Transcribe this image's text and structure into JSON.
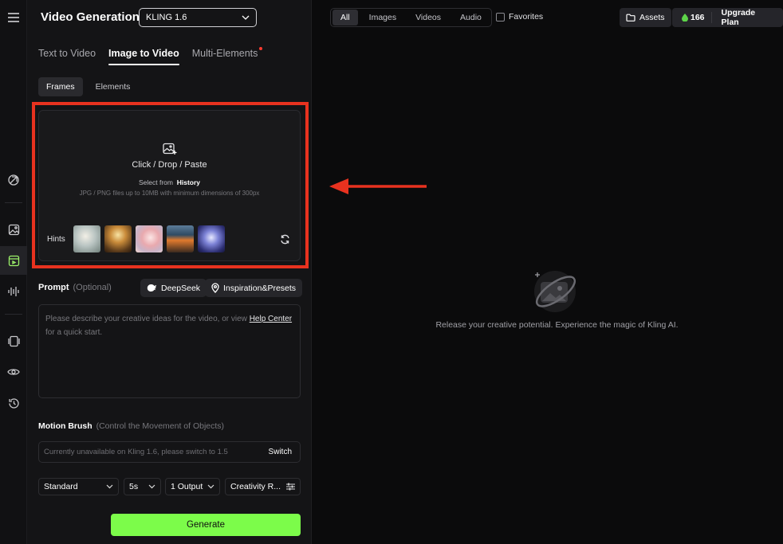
{
  "app": {
    "title": "Video Generation",
    "model": "KLING 1.6"
  },
  "tabs": [
    {
      "label": "Text to Video",
      "active": false
    },
    {
      "label": "Image to Video",
      "active": true
    },
    {
      "label": "Multi-Elements",
      "active": false,
      "badge": true
    }
  ],
  "subtabs": [
    {
      "label": "Frames",
      "active": true
    },
    {
      "label": "Elements",
      "active": false
    }
  ],
  "upload": {
    "main_label": "Click / Drop / Paste",
    "select_prefix": "Select from",
    "select_link": "History",
    "limits": "JPG / PNG files up to 10MB with minimum dimensions of 300px",
    "hints_label": "Hints"
  },
  "prompt": {
    "label": "Prompt",
    "optional": "(Optional)",
    "deepseek": "DeepSeek",
    "inspiration": "Inspiration&Presets",
    "placeholder_start": "Please describe your creative ideas for the video, or view",
    "help_link": "Help Center",
    "placeholder_end": "for a quick start."
  },
  "motion": {
    "label": "Motion Brush",
    "sublabel": "(Control the Movement of Objects)",
    "notice": "Currently unavailable on Kling 1.6, please switch to 1.5",
    "switch": "Switch"
  },
  "options": {
    "mode": "Standard",
    "duration": "5s",
    "outputs": "1 Output",
    "creativity": "Creativity R..."
  },
  "generate_label": "Generate",
  "filters": [
    {
      "label": "All",
      "active": true
    },
    {
      "label": "Images",
      "active": false
    },
    {
      "label": "Videos",
      "active": false
    },
    {
      "label": "Audio",
      "active": false
    }
  ],
  "favorites_label": "Favorites",
  "assets_label": "Assets",
  "credits": "166",
  "upgrade_label": "Upgrade Plan",
  "empty_state": "Release your creative potential. Experience the magic of Kling AI.",
  "colors": {
    "accent_green": "#7cfc4a",
    "highlight_red": "#e8321f"
  }
}
